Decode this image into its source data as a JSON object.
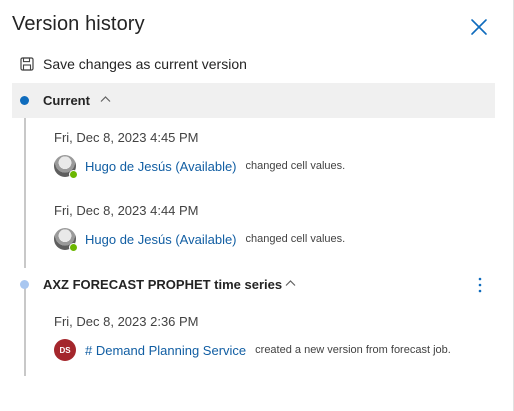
{
  "panel": {
    "title": "Version history",
    "save_label": "Save changes as current version"
  },
  "groups": [
    {
      "title": "Current",
      "entries": [
        {
          "time": "Fri, Dec 8, 2023 4:45 PM",
          "user": "Hugo de Jesús (Available)",
          "action": "changed cell values."
        },
        {
          "time": "Fri, Dec 8, 2023 4:44 PM",
          "user": "Hugo de Jesús (Available)",
          "action": "changed cell values."
        }
      ]
    },
    {
      "title": "AXZ FORECAST PROPHET time series",
      "entries": [
        {
          "time": "Fri, Dec 8, 2023 2:36 PM",
          "avatar_initials": "DS",
          "user": "# Demand Planning Service",
          "action": "created a new version from forecast job."
        }
      ]
    }
  ],
  "colors": {
    "accent": "#0f6cbd",
    "link": "#115ea3",
    "current_dot": "#0f6cbd",
    "other_dot": "#a9c7f0",
    "presence": "#6bb700",
    "service_avatar": "#a4262c"
  },
  "icons": {
    "close": "close-icon",
    "save": "save-icon",
    "chevron": "chevron-up-icon",
    "more": "more-vertical-icon"
  }
}
